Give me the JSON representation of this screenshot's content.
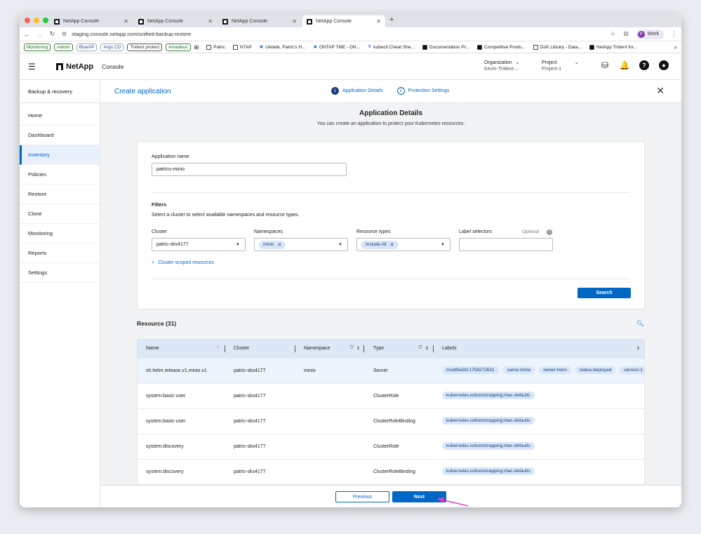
{
  "browser": {
    "tabs": [
      {
        "title": "NetApp Console"
      },
      {
        "title": "NetApp Console"
      },
      {
        "title": "NetApp Console"
      },
      {
        "title": "NetApp Console"
      }
    ],
    "url": "staging.console.netapp.com/unified-backup-restore",
    "profile_initial": "P",
    "profile_label": "Work",
    "bookmarks_chips": [
      "Monitoring",
      "Admin",
      "BlueXP",
      "Argo CD",
      "Trident protect",
      "Amadeus"
    ],
    "bookmarks": [
      "Patric",
      "NTAP",
      "Uebele, Patric's H...",
      "ONTAP TME - ON...",
      "kubectl Cheat She...",
      "Documentation Pr...",
      "Competitive Produ...",
      "DoK Library - Data...",
      "NetApp Trident for..."
    ]
  },
  "header": {
    "brand": "NetApp",
    "product": "Console",
    "org_label": "Organization",
    "org_value": "Kevin-Trident-...",
    "project_label": "Project",
    "project_value": "Project-1"
  },
  "sidebar": {
    "title": "Backup & recovery",
    "items": [
      "Home",
      "Dashboard",
      "Inventory",
      "Policies",
      "Restore",
      "Clone",
      "Monitoring",
      "Reports",
      "Settings"
    ]
  },
  "wizard": {
    "title": "Create application",
    "steps": [
      {
        "num": "1",
        "label": "Application Details"
      },
      {
        "num": "2",
        "label": "Protection Settings"
      }
    ]
  },
  "details": {
    "title": "Application Details",
    "subtitle": "You can create an application to protect your Kubernetes resources."
  },
  "form": {
    "app_name_label": "Application name",
    "app_name_value": "patricu-minio",
    "filters_title": "Filters",
    "filters_desc": "Select a cluster to select available namespaces and resource types.",
    "cluster_label": "Cluster",
    "cluster_value": "patric-sks4177",
    "namespaces_label": "Namespaces",
    "namespace_chip": "minio",
    "resource_types_label": "Resource types",
    "resource_type_chip": "Include All",
    "label_selectors_label": "Label selectors",
    "optional_text": "Optional",
    "cluster_scoped_link": "Cluster-scoped resources",
    "search_button": "Search"
  },
  "resources": {
    "title": "Resource (31)",
    "columns": [
      "Name",
      "Cluster",
      "Namespace",
      "Type",
      "Labels"
    ],
    "rows": [
      {
        "name": "sh.helm.release.v1.minio.v1",
        "cluster": "patric-sks4177",
        "namespace": "minio",
        "type": "Secret",
        "labels": [
          "modifiedAt:1758272631",
          "name:minio",
          "owner:helm",
          "status:deployed",
          "version:1"
        ]
      },
      {
        "name": "system:basic-user",
        "cluster": "patric-sks4177",
        "namespace": "",
        "type": "ClusterRole",
        "labels": [
          "kubernetes.io/bootstrapping:rbac-defaults"
        ]
      },
      {
        "name": "system:basic-user",
        "cluster": "patric-sks4177",
        "namespace": "",
        "type": "ClusterRoleBinding",
        "labels": [
          "kubernetes.io/bootstrapping:rbac-defaults"
        ]
      },
      {
        "name": "system:discovery",
        "cluster": "patric-sks4177",
        "namespace": "",
        "type": "ClusterRole",
        "labels": [
          "kubernetes.io/bootstrapping:rbac-defaults"
        ]
      },
      {
        "name": "system:discovery",
        "cluster": "patric-sks4177",
        "namespace": "",
        "type": "ClusterRoleBinding",
        "labels": [
          "kubernetes.io/bootstrapping:rbac-defaults"
        ]
      }
    ]
  },
  "footer": {
    "previous": "Previous",
    "next": "Next"
  },
  "colors": {
    "accent": "#0067c5",
    "header_row": "#dce8f6",
    "chip": "#d7e6f8",
    "cursor": "#e040c8"
  }
}
